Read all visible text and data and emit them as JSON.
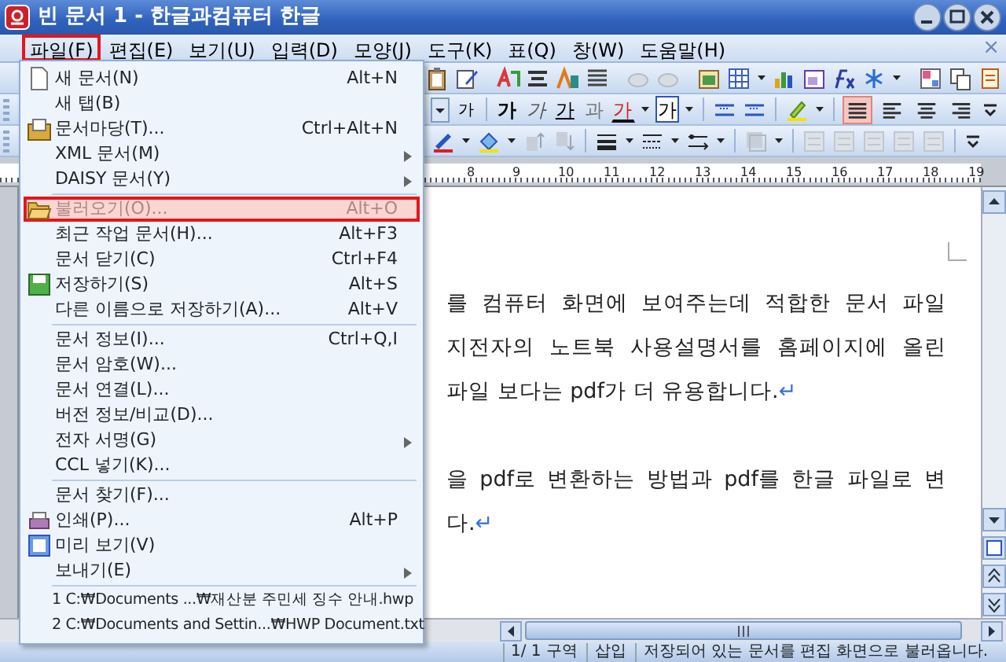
{
  "window": {
    "title": "빈 문서 1 - 한글과컴퓨터 한글"
  },
  "menu_bar": {
    "items": [
      {
        "label": "파일(F)",
        "selected": true
      },
      {
        "label": "편집(E)",
        "selected": false
      },
      {
        "label": "보기(U)",
        "selected": false
      },
      {
        "label": "입력(D)",
        "selected": false
      },
      {
        "label": "모양(J)",
        "selected": false
      },
      {
        "label": "도구(K)",
        "selected": false
      },
      {
        "label": "표(Q)",
        "selected": false
      },
      {
        "label": "창(W)",
        "selected": false
      },
      {
        "label": "도움말(H)",
        "selected": false
      }
    ],
    "close": "×"
  },
  "file_menu": {
    "items": [
      {
        "kind": "item",
        "label": "새 문서(N)",
        "shortcut": "Alt+N",
        "submenu": false,
        "selected": false
      },
      {
        "kind": "item",
        "label": "새 탭(B)",
        "submenu": false,
        "selected": false
      },
      {
        "kind": "item",
        "label": "문서마당(T)...",
        "shortcut": "Ctrl+Alt+N",
        "submenu": false,
        "selected": false
      },
      {
        "kind": "item",
        "label": "XML 문서(M)",
        "submenu": true,
        "selected": false
      },
      {
        "kind": "item",
        "label": "DAISY 문서(Y)",
        "submenu": true,
        "selected": false
      },
      {
        "kind": "separator"
      },
      {
        "kind": "item",
        "label": "불러오기(O)...",
        "shortcut": "Alt+O",
        "submenu": false,
        "selected": true
      },
      {
        "kind": "item",
        "label": "최근 작업 문서(H)...",
        "shortcut": "Alt+F3",
        "submenu": false,
        "selected": false
      },
      {
        "kind": "item",
        "label": "문서 닫기(C)",
        "shortcut": "Ctrl+F4",
        "submenu": false,
        "selected": false
      },
      {
        "kind": "item",
        "label": "저장하기(S)",
        "shortcut": "Alt+S",
        "submenu": false,
        "selected": false
      },
      {
        "kind": "item",
        "label": "다른 이름으로 저장하기(A)...",
        "shortcut": "Alt+V",
        "submenu": false,
        "selected": false
      },
      {
        "kind": "separator"
      },
      {
        "kind": "item",
        "label": "문서 정보(I)...",
        "shortcut": "Ctrl+Q,I",
        "submenu": false,
        "selected": false
      },
      {
        "kind": "item",
        "label": "문서 암호(W)...",
        "submenu": false,
        "selected": false
      },
      {
        "kind": "item",
        "label": "문서 연결(L)...",
        "submenu": false,
        "selected": false
      },
      {
        "kind": "item",
        "label": "버전 정보/비교(D)...",
        "submenu": false,
        "selected": false
      },
      {
        "kind": "item",
        "label": "전자 서명(G)",
        "submenu": true,
        "selected": false
      },
      {
        "kind": "item",
        "label": "CCL 넣기(K)...",
        "submenu": false,
        "selected": false
      },
      {
        "kind": "separator"
      },
      {
        "kind": "item",
        "label": "문서 찾기(F)...",
        "submenu": false,
        "selected": false
      },
      {
        "kind": "item",
        "label": "인쇄(P)...",
        "shortcut": "Alt+P",
        "submenu": false,
        "selected": false
      },
      {
        "kind": "item",
        "label": "미리 보기(V)",
        "submenu": false,
        "selected": false
      },
      {
        "kind": "item",
        "label": "보내기(E)",
        "submenu": true,
        "selected": false
      },
      {
        "kind": "separator"
      },
      {
        "kind": "recent",
        "label": "1 C:₩Documents ...₩재산분 주민세 징수 안내.hwp",
        "selected": false
      },
      {
        "kind": "recent",
        "label": "2 C:₩Documents and Settin...₩HWP Document.txt",
        "selected": false
      }
    ]
  },
  "format_buttons": [
    {
      "kind": "superscript",
      "label": "가"
    },
    {
      "kind": "bold",
      "label": "가"
    },
    {
      "kind": "italic",
      "label": "가"
    },
    {
      "kind": "underline",
      "label": "가"
    },
    {
      "kind": "outline",
      "label": "과"
    },
    {
      "kind": "color",
      "label": "가"
    },
    {
      "kind": "boxed",
      "label": "가"
    }
  ],
  "align_buttons": [
    {
      "selected": true
    },
    {
      "selected": false
    },
    {
      "selected": false
    },
    {
      "selected": false
    }
  ],
  "ruler": {
    "numbers": [
      "8",
      "9",
      "10",
      "11",
      "12",
      "13",
      "14",
      "15",
      "16",
      "17",
      "18",
      "19"
    ]
  },
  "document": {
    "lines": [
      {
        "kind": "full",
        "text": "를 컴퓨터 화면에 보여주는데 적합한 문서 파일"
      },
      {
        "kind": "full",
        "text": "지전자의 노트북 사용설명서를 홈페이지에 올린"
      },
      {
        "kind": "end",
        "text": "파일 보다는 pdf가 더 유용합니다.",
        "end_mark": "↵"
      },
      {
        "kind": "blank"
      },
      {
        "kind": "full",
        "text": "을 pdf로 변환하는 방법과 pdf를 한글 파일로 변"
      },
      {
        "kind": "end",
        "text": "다.",
        "end_mark": "↵"
      }
    ]
  },
  "status_bar": {
    "page": "1/ 1 구역",
    "mode": "삽입",
    "message": "저장되어 있는 문서를 편집 화면으로 불러옵니다."
  }
}
